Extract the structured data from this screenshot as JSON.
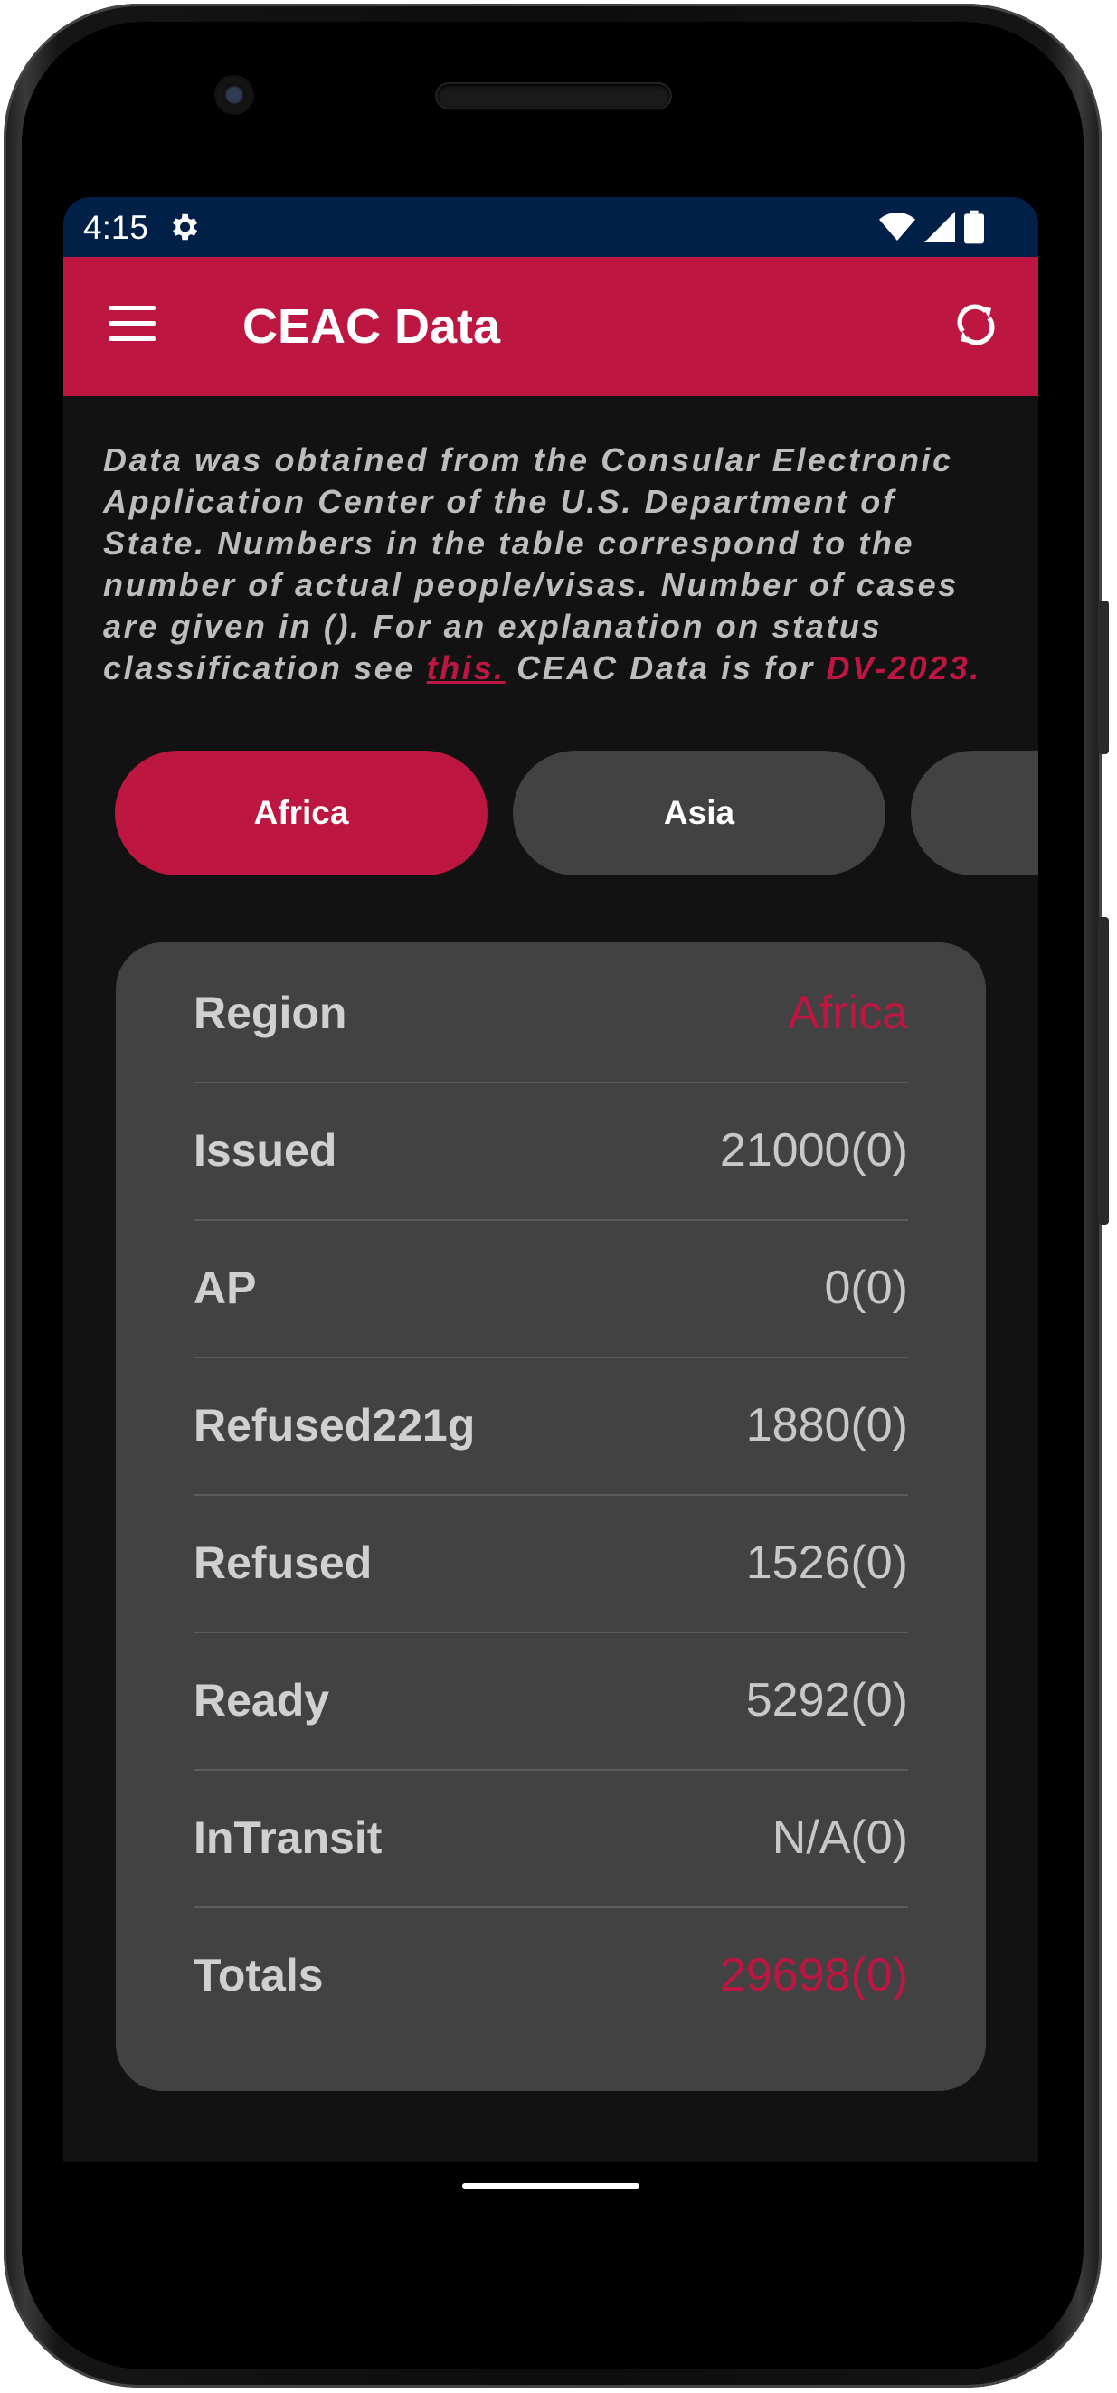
{
  "status": {
    "time": "4:15"
  },
  "appbar": {
    "title": "CEAC Data"
  },
  "intro": {
    "text_1": "Data was obtained from the Consular Electronic Application Center of the U.S. Department of State. Numbers in the table correspond to the number of actual people/visas. Number of cases are given in (). For an explanation on status classification see ",
    "link": "this.",
    "text_2": " CEAC Data is for ",
    "program": "DV-2023."
  },
  "chips": [
    {
      "label": "Africa",
      "active": true
    },
    {
      "label": "Asia",
      "active": false
    },
    {
      "label": "",
      "active": false
    }
  ],
  "table": {
    "rows": [
      {
        "label": "Region",
        "value": "Africa"
      },
      {
        "label": "Issued",
        "value": "21000(0)"
      },
      {
        "label": "AP",
        "value": "0(0)"
      },
      {
        "label": "Refused221g",
        "value": "1880(0)"
      },
      {
        "label": "Refused",
        "value": "1526(0)"
      },
      {
        "label": "Ready",
        "value": "5292(0)"
      },
      {
        "label": "InTransit",
        "value": "N/A(0)"
      },
      {
        "label": "Totals",
        "value": "29698(0)"
      }
    ]
  },
  "colors": {
    "accent": "#BD1640",
    "statusbar": "#012048",
    "surface": "#424242",
    "background": "#121212"
  },
  "icons": [
    "gear-icon",
    "wifi-icon",
    "signal-icon",
    "battery-icon",
    "menu-icon",
    "refresh-icon"
  ]
}
